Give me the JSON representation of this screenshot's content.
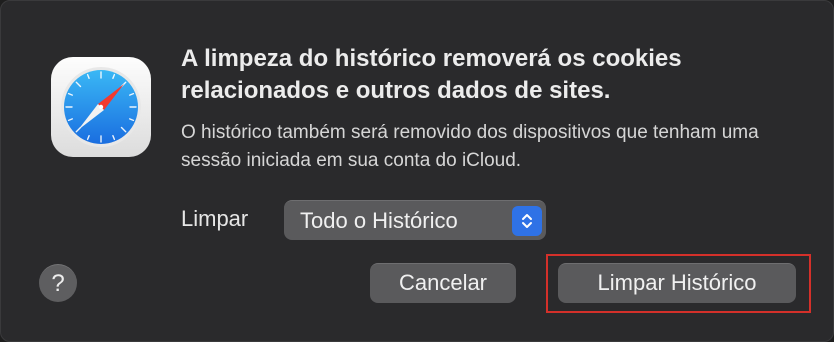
{
  "dialog": {
    "title": "A limpeza do histórico removerá os cookies relacionados e outros dados de sites.",
    "message": "O histórico também será removido dos dispositivos que tenham uma sessão iniciada em sua conta do iCloud.",
    "app_icon": "safari-compass-icon"
  },
  "clear_range": {
    "label": "Limpar",
    "selected": "Todo o Histórico"
  },
  "buttons": {
    "help": "?",
    "cancel": "Cancelar",
    "clear_history": "Limpar Histórico"
  },
  "colors": {
    "accent": "#2f72e6",
    "highlight": "#d4302a"
  }
}
